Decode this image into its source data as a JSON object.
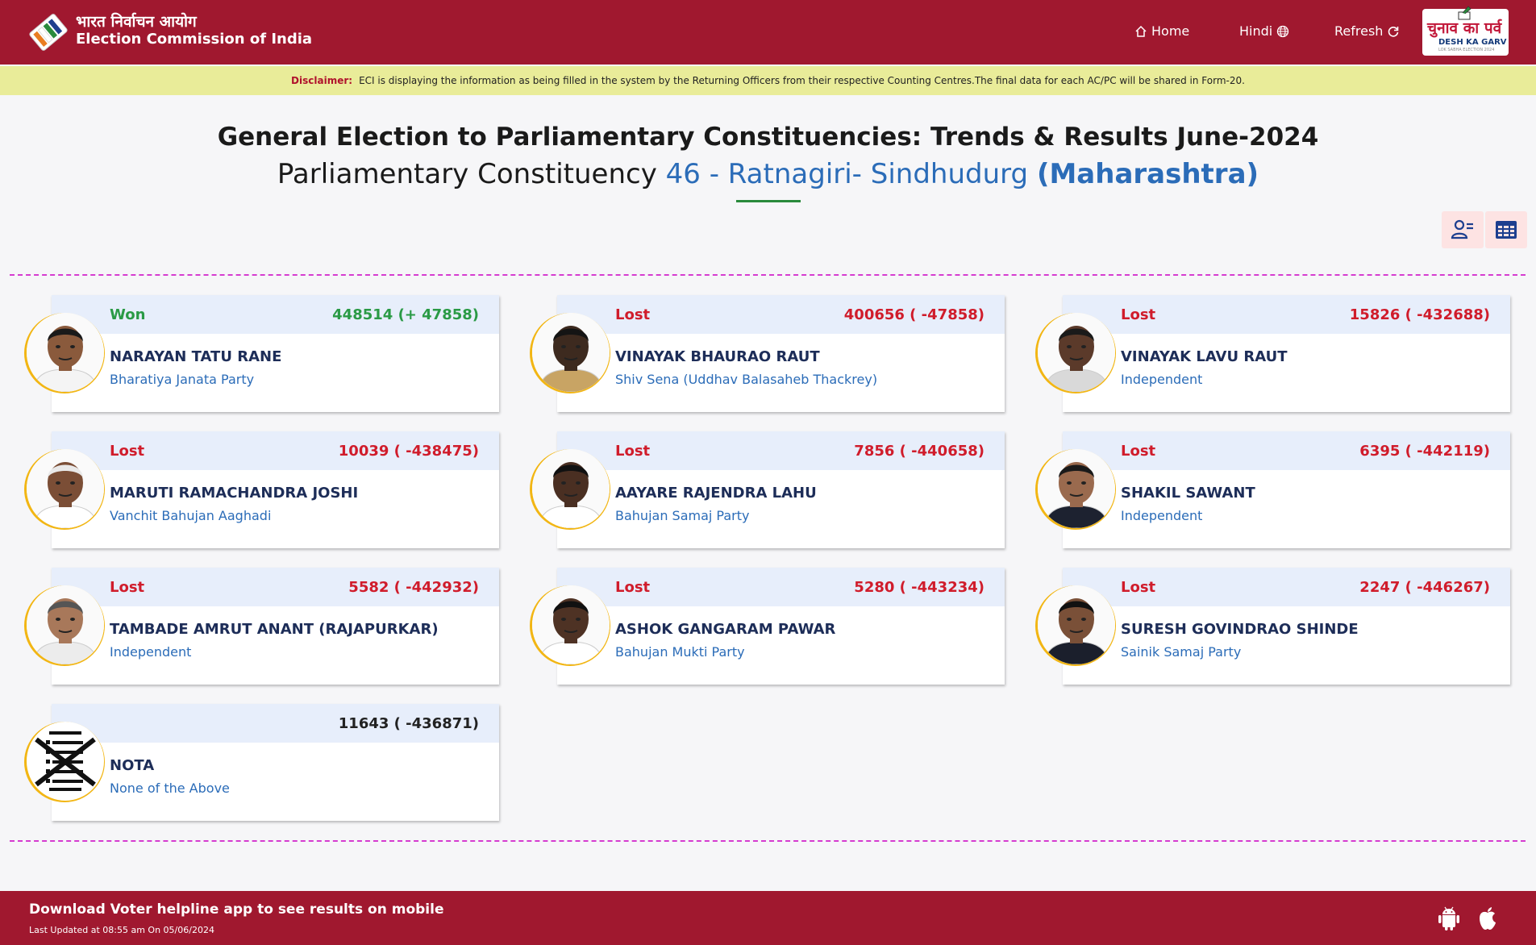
{
  "header": {
    "brand_hindi": "भारत निर्वाचन आयोग",
    "brand_english": "Election Commission of India",
    "nav": {
      "home": "Home",
      "hindi": "Hindi",
      "refresh": "Refresh"
    },
    "badge": {
      "hindi": "चुनाव का पर्व",
      "english": "DESH KA GARV",
      "sub": "LOK SABHA ELECTION 2024"
    },
    "icons": [
      "home-icon",
      "globe-icon",
      "refresh-icon"
    ]
  },
  "disclaimer": {
    "label": "Disclaimer:",
    "text": "ECI is displaying the information as being filled in the system by the Returning Officers from their respective Counting Centres.The final data for each AC/PC will be shared in Form-20."
  },
  "title": {
    "line1": "General Election to Parliamentary Constituencies: Trends & Results June-2024",
    "line2_prefix": "Parliamentary Constituency",
    "constituency": "46 - Ratnagiri- Sindhudurg",
    "state": "(Maharashtra)"
  },
  "view_icons": [
    "candidate-list-icon",
    "table-view-icon"
  ],
  "candidates": [
    {
      "status": "Won",
      "votes": "448514 (+ 47858)",
      "name": "NARAYAN TATU RANE",
      "party": "Bharatiya Janata Party"
    },
    {
      "status": "Lost",
      "votes": "400656 ( -47858)",
      "name": "VINAYAK BHAURAO RAUT",
      "party": "Shiv Sena (Uddhav Balasaheb Thackrey)"
    },
    {
      "status": "Lost",
      "votes": "15826 ( -432688)",
      "name": "VINAYAK LAVU RAUT",
      "party": "Independent"
    },
    {
      "status": "Lost",
      "votes": "10039 ( -438475)",
      "name": "MARUTI RAMACHANDRA JOSHI",
      "party": "Vanchit Bahujan Aaghadi"
    },
    {
      "status": "Lost",
      "votes": "7856 ( -440658)",
      "name": "AAYARE RAJENDRA LAHU",
      "party": "Bahujan Samaj Party"
    },
    {
      "status": "Lost",
      "votes": "6395 ( -442119)",
      "name": "SHAKIL SAWANT",
      "party": "Independent"
    },
    {
      "status": "Lost",
      "votes": "5582 ( -442932)",
      "name": "TAMBADE AMRUT ANANT (RAJAPURKAR)",
      "party": "Independent"
    },
    {
      "status": "Lost",
      "votes": "5280 ( -443234)",
      "name": "ASHOK GANGARAM PAWAR",
      "party": "Bahujan Mukti Party"
    },
    {
      "status": "Lost",
      "votes": "2247 ( -446267)",
      "name": "SURESH GOVINDRAO SHINDE",
      "party": "Sainik Samaj Party"
    },
    {
      "status": "",
      "votes": "11643 ( -436871)",
      "name": "NOTA",
      "party": "None of the Above"
    }
  ],
  "footer": {
    "line1": "Download Voter helpline app to see results on mobile",
    "line2": "Last Updated at 08:55 am On 05/06/2024",
    "icons": [
      "android-icon",
      "apple-icon"
    ]
  },
  "colors": {
    "brand": "#a0182f",
    "won": "#2a9a45",
    "lost": "#d01c2b",
    "accent_blue": "#2b6cb8",
    "disclaimer_bg": "#e9ec99"
  }
}
